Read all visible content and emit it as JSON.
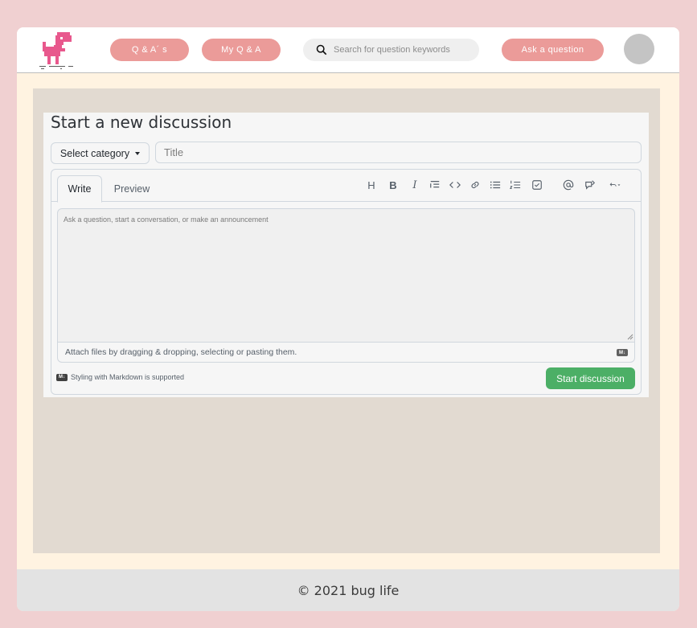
{
  "nav": {
    "qa_label": "Q & A´ s",
    "my_qa_label": "My Q & A",
    "search_placeholder": "Search for question keywords",
    "ask_label": "Ask a question"
  },
  "discussion": {
    "heading": "Start a new discussion",
    "category_label": "Select category",
    "title_placeholder": "Title",
    "tabs": {
      "write": "Write",
      "preview": "Preview"
    },
    "toolbar": [
      "heading",
      "bold",
      "italic",
      "quote",
      "code",
      "link",
      "bulleted-list",
      "numbered-list",
      "task-list",
      "mention",
      "reference",
      "undo"
    ],
    "body_placeholder": "Ask a question, start a conversation, or make an announcement",
    "attach_text": "Attach files by dragging & dropping, selecting or pasting them.",
    "markdown_note": "Styling with Markdown is supported",
    "markdown_badge": "M↓",
    "submit_label": "Start discussion"
  },
  "footer": {
    "text": "© 2021 bug life"
  },
  "colors": {
    "page_bg": "#f0d0d1",
    "frame_bg": "#fff3e1",
    "pill": "#eb9b99",
    "content_bg": "#e2dad1",
    "submit": "#4caf66"
  }
}
